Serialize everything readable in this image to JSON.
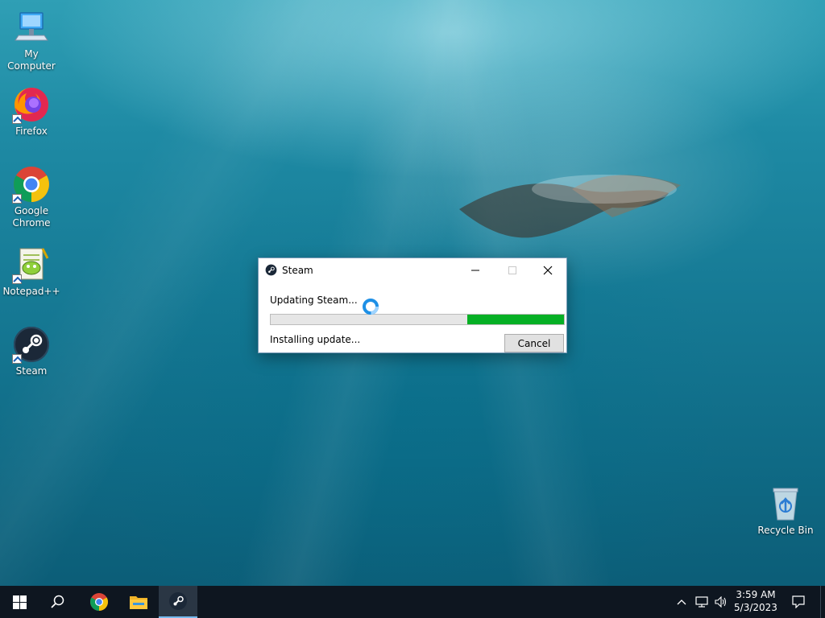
{
  "desktop": {
    "icons": [
      {
        "label": "My Computer",
        "icon": "computer-icon"
      },
      {
        "label": "Firefox",
        "icon": "firefox-icon"
      },
      {
        "label": "Google Chrome",
        "icon": "chrome-icon"
      },
      {
        "label": "Notepad++",
        "icon": "notepadpp-icon"
      },
      {
        "label": "Steam",
        "icon": "steam-icon"
      },
      {
        "label": "Recycle Bin",
        "icon": "recycle-bin-icon"
      }
    ]
  },
  "dialog": {
    "title": "Steam",
    "status_text": "Updating Steam...",
    "detail_text": "Installing update...",
    "progress_fraction": 0.33,
    "cancel_label": "Cancel",
    "progress_color": "#06b025"
  },
  "taskbar": {
    "items": [
      "start-icon",
      "search-icon",
      "chrome-icon",
      "file-explorer-icon",
      "steam-icon"
    ],
    "active_item": "steam",
    "tray_icons": [
      "chevron-up-icon",
      "network-icon",
      "volume-icon",
      "notification-icon"
    ],
    "time": "3:59 AM",
    "date": "5/3/2023"
  }
}
